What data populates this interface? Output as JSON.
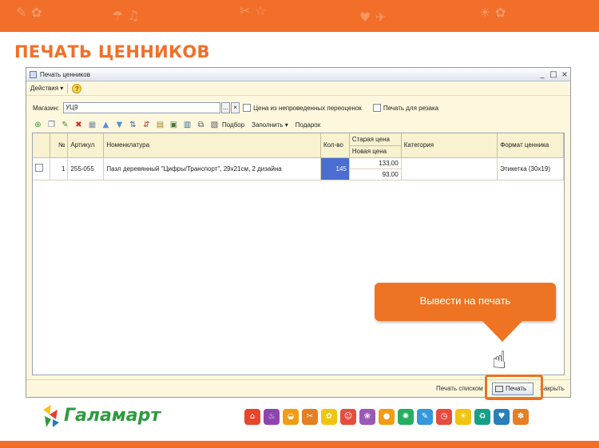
{
  "slide_title": "ПЕЧАТЬ ЦЕННИКОВ",
  "window": {
    "title": "Печать ценников",
    "controls": [
      "_",
      "□",
      "×"
    ]
  },
  "menu": {
    "actions_label": "Действия",
    "actions_arrow": "▾",
    "help_label": "?"
  },
  "shop": {
    "label": "Магазин:",
    "value": "УЦ9",
    "select_btn": "...",
    "clear_btn": "×"
  },
  "options": {
    "unposted_price_label": "Цена из непроведенных переоценок",
    "cutting_print_label": "Печать для резака"
  },
  "toolbar": {
    "pick_label": "Подбор",
    "fill_label": "Заполнить",
    "fill_arrow": "▾",
    "gift_label": "Подарок"
  },
  "table": {
    "headers": {
      "num": "№",
      "article": "Артикул",
      "item": "Номенклатура",
      "qty": "Кол-во",
      "old_price": "Старая цена",
      "new_price": "Новая цена",
      "category": "Категория",
      "format": "Формат ценника"
    },
    "rows": [
      {
        "num": "1",
        "article": "255-055",
        "item": "Пазл деревянный \"Цифры/Транспорт\", 29x21см, 2 дизайна",
        "qty": "145",
        "old_price": "133,00",
        "new_price": "93,00",
        "category": "",
        "format": "Этикетка (30x19)"
      }
    ]
  },
  "footer": {
    "print_list_label": "Печать списком",
    "print_label": "Печать",
    "close_label": "Закрыть"
  },
  "callout": {
    "text": "Вывести на печать"
  },
  "brand": {
    "logo_text": "Галамарт"
  },
  "colors": {
    "accent": "#f26f2a",
    "brand_green": "#2d9b3e",
    "selection_blue": "#4a6ed0"
  }
}
